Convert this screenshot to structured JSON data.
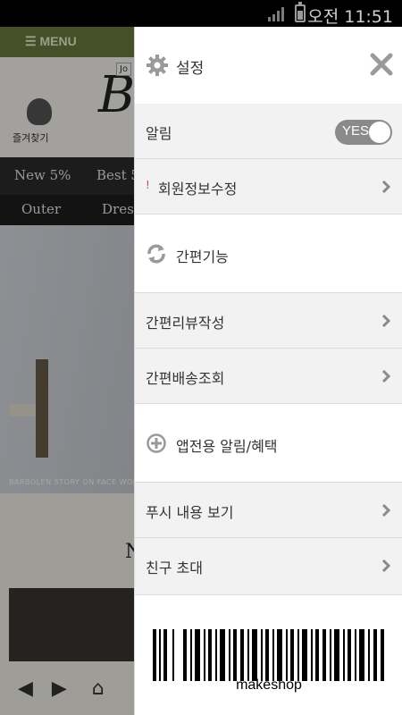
{
  "status_bar": {
    "time": "오전 11:51"
  },
  "background_app": {
    "menu_label": "MENU",
    "logo_text": "B",
    "tag_text": "Jo",
    "favorites_label": "즐겨찾기",
    "nav_row1": [
      "New 5%",
      "Best 5"
    ],
    "nav_row2": [
      "Outer",
      "Dres"
    ],
    "hero_caption": "BARBOLEN STORY ON  FACE WOMAN",
    "section_letter": "N"
  },
  "drawer": {
    "title": "설정",
    "notifications": {
      "label": "알림",
      "toggle_value": "YES",
      "enabled": true
    },
    "member_edit": {
      "label": "회원정보수정",
      "alert_mark": "!"
    },
    "quick_section": {
      "title": "간편기능"
    },
    "quick_items": [
      {
        "label": "간편리뷰작성"
      },
      {
        "label": "간편배송조회"
      }
    ],
    "app_section": {
      "title": "앱전용 알림/혜택"
    },
    "app_items": [
      {
        "label": "푸시 내용 보기"
      },
      {
        "label": "친구 초대"
      }
    ],
    "barcode_text": "makeshop"
  },
  "colors": {
    "menu_bar": "#6a7b3e",
    "drawer_bg": "#ffffff",
    "row_bg": "#f2f2f2",
    "toggle_bg": "#8a8a8a",
    "icon_gray": "#9a9a9a",
    "alert_red": "#d24a4a"
  }
}
